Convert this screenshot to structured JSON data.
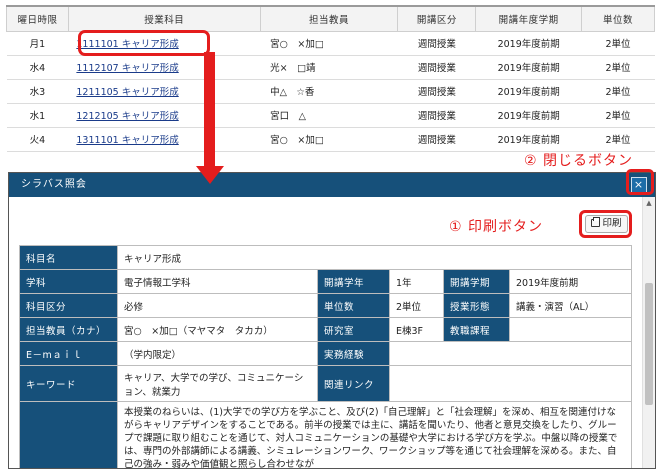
{
  "course_table": {
    "headers": [
      "曜日時限",
      "授業科目",
      "担当教員",
      "開講区分",
      "開講年度学期",
      "単位数"
    ],
    "rows": [
      {
        "period": "月1",
        "course": "1111101 キャリア形成",
        "teacher": "宮○　×加□",
        "category": "週間授業",
        "term": "2019年度前期",
        "credits": "2単位"
      },
      {
        "period": "水4",
        "course": "1112107 キャリア形成",
        "teacher": "光×　□靖",
        "category": "週間授業",
        "term": "2019年度前期",
        "credits": "2単位"
      },
      {
        "period": "水3",
        "course": "1211105 キャリア形成",
        "teacher": "中△　☆香",
        "category": "週間授業",
        "term": "2019年度前期",
        "credits": "2単位"
      },
      {
        "period": "水1",
        "course": "1212105 キャリア形成",
        "teacher": "宮口　△",
        "category": "週間授業",
        "term": "2019年度前期",
        "credits": "2単位"
      },
      {
        "period": "火4",
        "course": "1311101 キャリア形成",
        "teacher": "宮○　×加□",
        "category": "週間授業",
        "term": "2019年度前期",
        "credits": "2単位"
      }
    ]
  },
  "annotations": {
    "close_label": "② 閉じるボタン",
    "print_label": "① 印刷ボタン"
  },
  "modal": {
    "title": "シラバス照会",
    "close_glyph": "×",
    "print_label": "印刷"
  },
  "syllabus": {
    "course_name_label": "科目名",
    "course_name": "キャリア形成",
    "dept_label": "学科",
    "dept": "電子情報工学科",
    "year_label": "開講学年",
    "year": "1年",
    "term_label": "開講学期",
    "term": "2019年度前期",
    "category_label": "科目区分",
    "category": "必修",
    "credits_label": "単位数",
    "credits": "2単位",
    "format_label": "授業形態",
    "format": "講義・演習（AL）",
    "teacher_label": "担当教員（カナ）",
    "teacher": "宮○　×加□（マヤマタ　タカカ）",
    "room_label": "研究室",
    "room": "E棟3F",
    "teaching_label": "教職課程",
    "teaching": "",
    "email_label": "E－mａｉｌ",
    "email": "（学内限定）",
    "experience_label": "実務経験",
    "experience": "",
    "keywords_label": "キーワード",
    "keywords": "キャリア、大学での学び、コミュニケーション、就業力",
    "links_label": "関連リンク",
    "links": "",
    "description": "本授業のねらいは、(1)大学での学び方を学ぶこと、及び(2)「自己理解」と「社会理解」を深め、相互を関連付けながらキャリアデザインをすることである。前半の授業では主に、講話を聞いたり、他者と意見交換をしたり、グループで課題に取り組むことを通じて、対人コミュニケーションの基礎や大学における学び方を学ぶ。中盤以降の授業では、専門の外部講師による講義、シミュレーションワーク、ワークショップ等を通じて社会理解を深める。また、自己の強み・弱みや価値観と照らし合わせなが"
  }
}
